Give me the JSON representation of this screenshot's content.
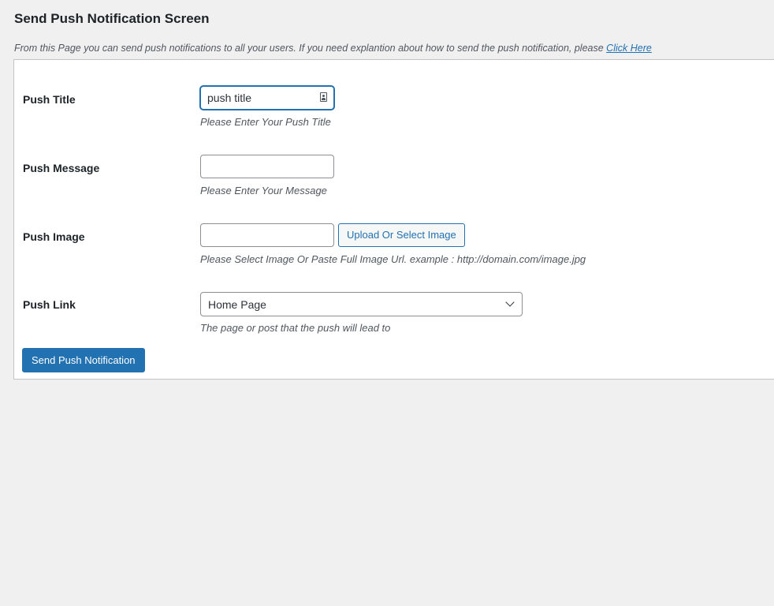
{
  "page": {
    "title": "Send Push Notification Screen",
    "intro_text": "From this Page you can send push notifications to all your users. If you need explantion about how to send the push notification, please ",
    "intro_link": "Click Here"
  },
  "form": {
    "push_title": {
      "label": "Push Title",
      "value": "push title",
      "help": "Please Enter Your Push Title",
      "icon": "contact-card-icon"
    },
    "push_message": {
      "label": "Push Message",
      "value": "",
      "help": "Please Enter Your Message"
    },
    "push_image": {
      "label": "Push Image",
      "value": "",
      "button_label": "Upload Or Select Image",
      "help": "Please Select Image Or Paste Full Image Url. example : http://domain.com/image.jpg"
    },
    "push_link": {
      "label": "Push Link",
      "selected": "Home Page",
      "help": "The page or post that the push will lead to",
      "icon": "chevron-down-icon"
    },
    "submit_label": "Send Push Notification"
  },
  "colors": {
    "background": "#f0f0f1",
    "panel": "#ffffff",
    "accent": "#2271b1",
    "text": "#1d2327",
    "help_text": "#50575e"
  }
}
